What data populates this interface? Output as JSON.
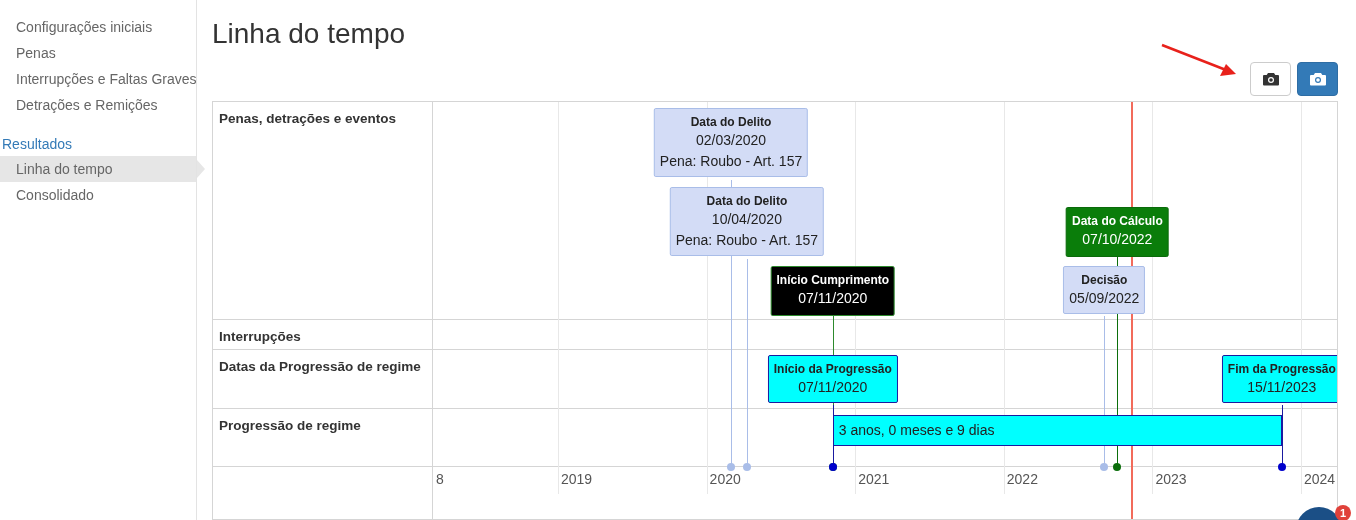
{
  "sidebar": {
    "sections": [
      {
        "items": [
          {
            "label": "Configurações iniciais",
            "selected": false
          },
          {
            "label": "Penas",
            "selected": false
          },
          {
            "label": "Interrupções e Faltas Graves",
            "selected": false
          },
          {
            "label": "Detrações e Remições",
            "selected": false
          }
        ]
      },
      {
        "title": "Resultados",
        "items": [
          {
            "label": "Linha do tempo",
            "selected": true
          },
          {
            "label": "Consolidado",
            "selected": false
          }
        ]
      }
    ]
  },
  "page": {
    "title": "Linha do tempo"
  },
  "toolbar": {
    "buttons": [
      {
        "kind": "default"
      },
      {
        "kind": "primary"
      }
    ]
  },
  "timeline": {
    "groups": [
      {
        "label": "Penas, detrações e eventos",
        "items": [
          {
            "kind": "delito",
            "title": "Data do Delito",
            "date": "02/03/2020",
            "detail": "Pena: Roubo - Art. 157"
          },
          {
            "kind": "delito",
            "title": "Data do Delito",
            "date": "10/04/2020",
            "detail": "Pena: Roubo - Art. 157"
          },
          {
            "kind": "inicio",
            "title": "Início Cumprimento",
            "date": "07/11/2020"
          },
          {
            "kind": "calculo",
            "title": "Data do Cálculo",
            "date": "07/10/2022"
          },
          {
            "kind": "decisao",
            "title": "Decisão",
            "date": "05/09/2022"
          }
        ]
      },
      {
        "label": "Interrupções"
      },
      {
        "label": "Datas da Progressão de regime",
        "items": [
          {
            "kind": "progressao",
            "title": "Início da Progressão",
            "date": "07/11/2020"
          },
          {
            "kind": "progressao",
            "title": "Fim da Progressão",
            "date": "15/11/2023"
          }
        ]
      },
      {
        "label": "Progressão de regime",
        "bar": {
          "label": "3 anos, 0 meses e 9 dias"
        }
      }
    ],
    "axis_labels": [
      "8",
      "2019",
      "2020",
      "2021",
      "2022",
      "2023",
      "2024"
    ]
  },
  "chat": {
    "badge": "1"
  }
}
